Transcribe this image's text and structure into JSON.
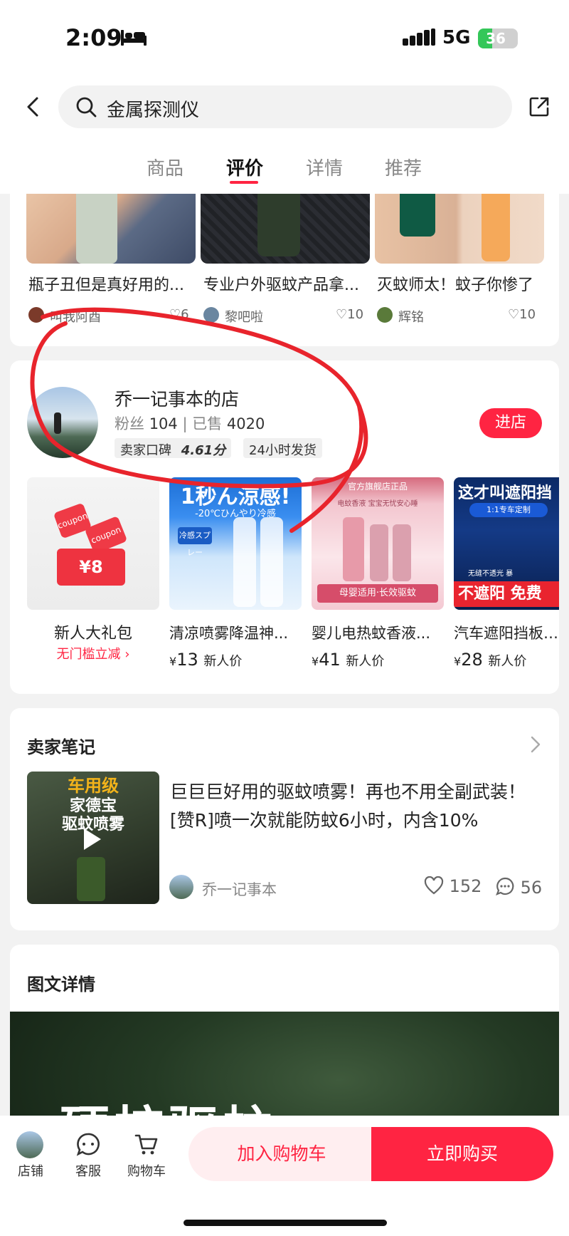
{
  "status_bar": {
    "time": "2:09",
    "network": "5G",
    "battery": "36",
    "battery_level": 0.36
  },
  "search": {
    "query": "金属探测仪"
  },
  "tabs": [
    {
      "label": "商品",
      "active": false
    },
    {
      "label": "评价",
      "active": true
    },
    {
      "label": "详情",
      "active": false
    },
    {
      "label": "推荐",
      "active": false
    }
  ],
  "top_products": [
    {
      "title": "瓶子丑但是真好用的...",
      "user": "叫我阿酉",
      "likes": "6"
    },
    {
      "title": "专业户外驱蚊产品拿...",
      "user": "黎吧啦",
      "likes": "10"
    },
    {
      "title": "灭蚊师太！蚊子你惨了",
      "user": "辉铭",
      "likes": "10"
    }
  ],
  "shop": {
    "name": "乔一记事本的店",
    "fans_label": "粉丝",
    "fans": "104",
    "sold_label": "已售",
    "sold": "4020",
    "rating_label": "卖家口碑",
    "rating": "4.61分",
    "shipping_tag": "24小时发货",
    "enter_label": "进店"
  },
  "shop_products": [
    {
      "title": "新人大礼包",
      "subtitle": "无门槛立减",
      "coupon": "¥8",
      "coupon_words": "coupon"
    },
    {
      "title": "清凉喷雾降温神...",
      "price": "13",
      "price_tag": "新人价",
      "banner": "1秒ん涼感!",
      "sub": "-20℃ひんやり冷感",
      "label": "冷感スプレー"
    },
    {
      "title": "婴儿电热蚊香液...",
      "price": "41",
      "price_tag": "新人价",
      "banner": "母婴适用·长效驱蚊",
      "top": "官方旗舰店正品",
      "sub": "电蚊香液 宝宝无忧安心睡"
    },
    {
      "title": "汽车遮阳挡板防...",
      "price": "28",
      "price_tag": "新人价",
      "banner": "这才叫遮阳挡",
      "sub": "1:1专车定制",
      "bottom": "不遮阳 免费",
      "small": "无缝不透光 暴"
    }
  ],
  "currency": "¥",
  "seller_notes": {
    "title": "卖家笔记",
    "thumb_text1": "车用级",
    "thumb_text2": "家德宝",
    "thumb_text3": "驱蚊喷雾",
    "text": "巨巨巨好用的驱蚊喷雾！再也不用全副武装！[赞R]喷一次就能防蚊6小时，内含10%",
    "author": "乔一记事本",
    "likes": "152",
    "comments": "56"
  },
  "detail": {
    "title": "图文详情",
    "banner_text": "硬核驱蚊"
  },
  "bottom_bar": {
    "shop_label": "店铺",
    "service_label": "客服",
    "cart_label": "购物车",
    "add_to_cart": "加入购物车",
    "buy_now": "立即购买"
  },
  "colors": {
    "accent": "#ff2442",
    "annotation": "#e8242c"
  }
}
